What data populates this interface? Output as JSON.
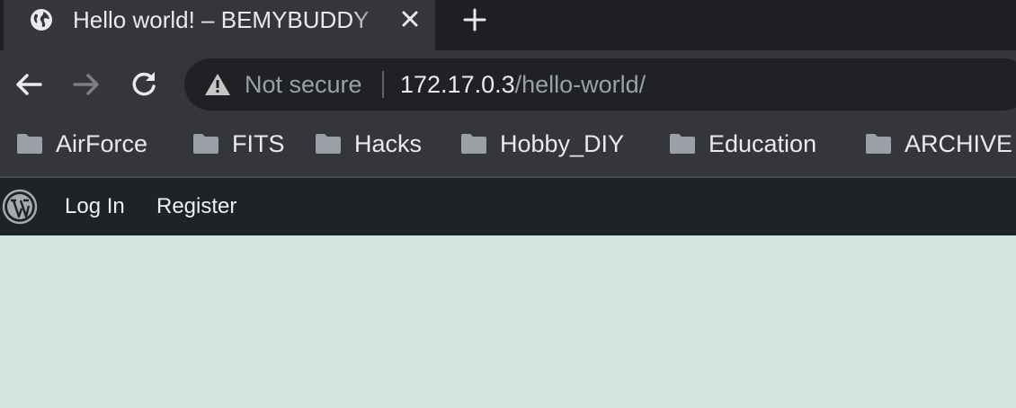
{
  "tab": {
    "title": "Hello world! – BEMYBUDDY",
    "favicon": "globe-icon",
    "close_icon": "close-icon"
  },
  "toolbar": {
    "security_label": "Not secure",
    "url_host": "172.17.0.3",
    "url_path": "/hello-world/"
  },
  "bookmarks": [
    {
      "label": "AirForce"
    },
    {
      "label": "FITS"
    },
    {
      "label": "Hacks"
    },
    {
      "label": "Hobby_DIY"
    },
    {
      "label": "Education"
    },
    {
      "label": "ARCHIVE"
    }
  ],
  "adminbar": {
    "logo": "wordpress-icon",
    "login_label": "Log In",
    "register_label": "Register"
  },
  "colors": {
    "tabstrip": "#1f2023",
    "toolbar": "#35363a",
    "omnibox": "#202124",
    "adminbar": "#1e2327",
    "page_background": "#d3e5df"
  }
}
